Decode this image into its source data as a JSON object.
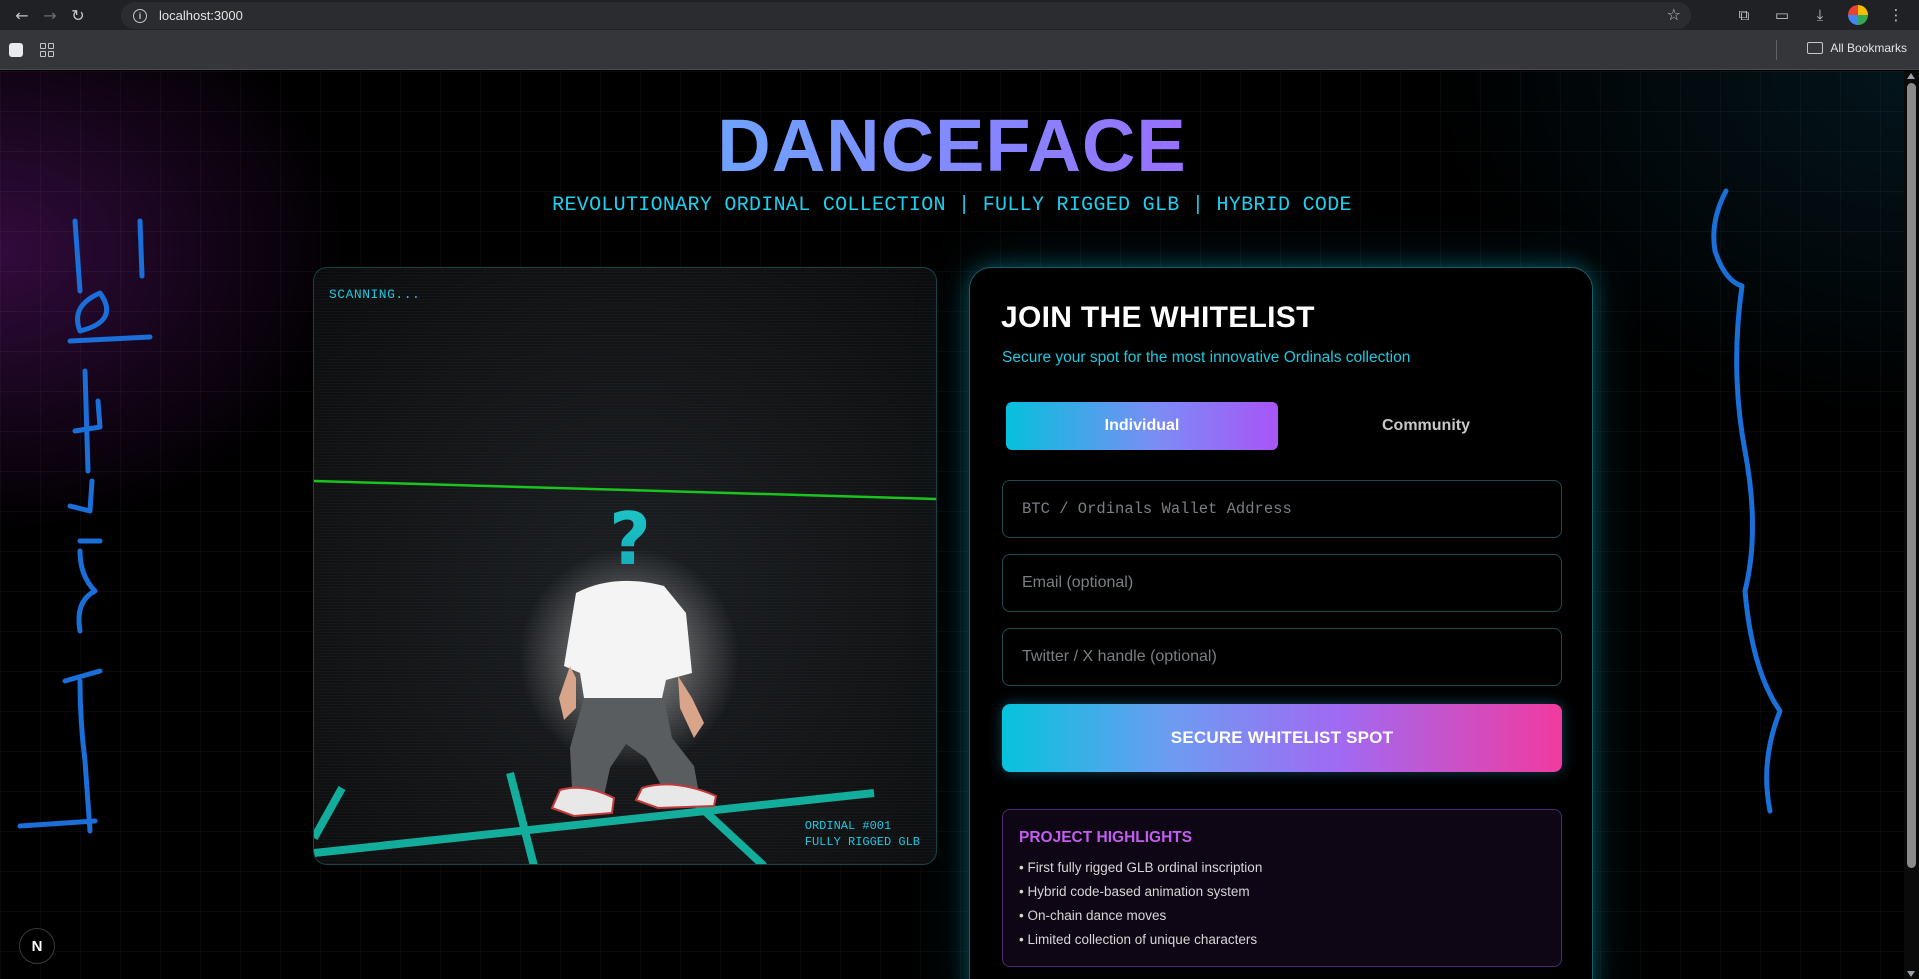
{
  "browser": {
    "url": "localhost:3000",
    "bookmarks_label": "All Bookmarks"
  },
  "header": {
    "title": "DANCEFACE",
    "subtitle": "REVOLUTIONARY ORDINAL COLLECTION | FULLY RIGGED GLB | HYBRID CODE"
  },
  "viewer": {
    "status": "SCANNING...",
    "ordinal_line1": "ORDINAL #001",
    "ordinal_line2": "FULLY RIGGED GLB",
    "head_glyph": "?"
  },
  "form": {
    "title": "JOIN THE WHITELIST",
    "lead": "Secure your spot for the most innovative Ordinals collection",
    "tabs": [
      {
        "label": "Individual",
        "active": true
      },
      {
        "label": "Community",
        "active": false
      }
    ],
    "wallet_placeholder": "BTC / Ordinals Wallet Address",
    "email_placeholder": "Email (optional)",
    "twitter_placeholder": "Twitter / X handle (optional)",
    "submit_label": "SECURE WHITELIST SPOT"
  },
  "highlights": {
    "title": "PROJECT HIGHLIGHTS",
    "items": [
      "• First fully rigged GLB ordinal inscription",
      "• Hybrid code-based animation system",
      "• On-chain dance moves",
      "• Limited collection of unique characters"
    ]
  },
  "dev_badge": "N",
  "colors": {
    "accent_cyan": "#1ec8e0",
    "accent_purple": "#a855f7",
    "accent_pink": "#f13aa0",
    "ink_blue": "#1a6fd8"
  }
}
